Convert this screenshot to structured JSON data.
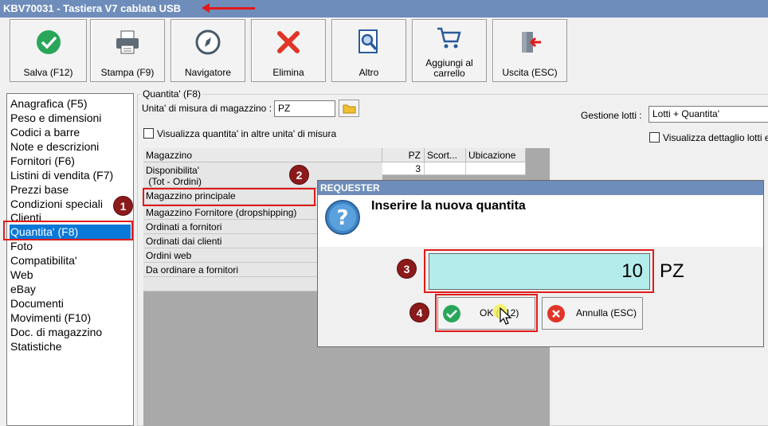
{
  "window": {
    "title": "KBV70031 - Tastiera V7 cablata USB"
  },
  "toolbar": {
    "buttons": [
      {
        "id": "save",
        "label": "Salva (F12)",
        "icon": "check-circle-icon"
      },
      {
        "id": "print",
        "label": "Stampa (F9)",
        "icon": "printer-icon"
      },
      {
        "id": "navigator",
        "label": "Navigatore",
        "icon": "compass-icon"
      },
      {
        "id": "delete",
        "label": "Elimina",
        "icon": "x-icon"
      },
      {
        "id": "other",
        "label": "Altro",
        "icon": "magnifier-document-icon"
      },
      {
        "id": "add-cart",
        "label": "Aggiungi al carrello",
        "label_line1": "Aggiungi al",
        "label_line2": "carrello",
        "icon": "shopping-cart-icon"
      },
      {
        "id": "exit",
        "label": "Uscita (ESC)",
        "icon": "exit-door-icon"
      }
    ]
  },
  "nav": {
    "items": [
      "Anagrafica (F5)",
      "Peso e dimensioni",
      "Codici a barre",
      "Note e descrizioni",
      "Fornitori (F6)",
      "Listini di vendita (F7)",
      "Prezzi base",
      "Condizioni speciali",
      "Clienti",
      "Quantita' (F8)",
      "Foto",
      "Compatibilita'",
      "Web",
      "eBay",
      "Documenti",
      "Movimenti (F10)",
      "Doc. di magazzino",
      "Statistiche"
    ],
    "selected": "Quantita' (F8)"
  },
  "quantity": {
    "group_title": "Quantita' (F8)",
    "uom_label": "Unita' di misura di magazzino :",
    "uom_value": "PZ",
    "show_other_units_label": "Visualizza quantita' in altre unita' di misura",
    "lot_label": "Gestione lotti :",
    "lot_value": "Lotti + Quantita'",
    "show_lot_detail_label": "Visualizza dettaglio lotti e"
  },
  "grid": {
    "headers": [
      "Magazzino",
      "PZ",
      "Scort...",
      "Ubicazione"
    ],
    "rows": [
      {
        "name_line1": "Disponibilita'",
        "name_line2": " (Tot - Ordini)",
        "pz": "3"
      },
      {
        "name": "Magazzino principale"
      },
      {
        "name": "Magazzino Fornitore (dropshipping)"
      },
      {
        "name": "Ordinati a fornitori"
      },
      {
        "name": "Ordinati dai clienti"
      },
      {
        "name": "Ordini web"
      },
      {
        "name": "Da ordinare a fornitori"
      }
    ]
  },
  "dialog": {
    "title": "REQUESTER",
    "message": "Inserire la nuova quantita",
    "input_value": "10",
    "unit": "PZ",
    "ok_label": "OK (F12)",
    "cancel_label": "Annulla (ESC)"
  },
  "badges": [
    "1",
    "2",
    "3",
    "4"
  ],
  "colors": {
    "titlebar": "#6f8dba",
    "selected": "#0a78d7",
    "highlight": "#e21a1a",
    "badge": "#8b1a1a",
    "input": "#b4ecec"
  }
}
